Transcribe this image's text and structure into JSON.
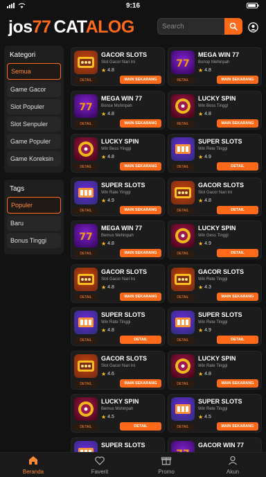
{
  "status": {
    "time": "9:16"
  },
  "header": {
    "logo_main": "jos",
    "logo_num": "77",
    "logo_cat": "CAT",
    "logo_alog": "ALOG",
    "search_placeholder": "Search"
  },
  "sidebar": {
    "categories_title": "Kategori",
    "categories": [
      {
        "label": "Semua",
        "active": true
      },
      {
        "label": "Game Gacor",
        "active": false
      },
      {
        "label": "Slot Populer",
        "active": false
      },
      {
        "label": "Slot Senpuler",
        "active": false
      },
      {
        "label": "Game Populer",
        "active": false
      },
      {
        "label": "Game Koreksin",
        "active": false
      }
    ],
    "tags_title": "Tags",
    "tags": [
      {
        "label": "Populer",
        "active": true
      },
      {
        "label": "Baru",
        "active": false
      },
      {
        "label": "Bonus Tinggi",
        "active": false
      }
    ]
  },
  "cards": [
    {
      "title": "GACOR SLOTS",
      "sub": "Slot Gacor Nari Ini",
      "rating": "4.8",
      "detail": "DETAIL",
      "action": "MAIN SEKARANG",
      "thumb": "gacor"
    },
    {
      "title": "MEGA WIN 77",
      "sub": "Bonop Mehinpah",
      "rating": "4.8",
      "detail": "RETAIL",
      "action": "MAIN SEKARANG",
      "thumb": "mega"
    },
    {
      "title": "MEGA WIN 77",
      "sub": "Bonce Mshinpah",
      "rating": "4.8",
      "detail": "DETAIL",
      "action": "MAIN SEKARANG",
      "thumb": "mega"
    },
    {
      "title": "LUCKY SPIN",
      "sub": "Win Boss Tinggl",
      "rating": "4.8",
      "detail": "RETAIL",
      "action": "MAIN SEKARANG",
      "thumb": "lucky"
    },
    {
      "title": "LUCKY SPIN",
      "sub": "Win Bess Yinggi",
      "rating": "4.8",
      "detail": "DETAIL",
      "action": "MAIN SEKARANG",
      "thumb": "lucky"
    },
    {
      "title": "SUPER SLOTS",
      "sub": "Win Rete Tinggi",
      "rating": "4.9",
      "detail": "DETAIL",
      "action": "DETAIL",
      "thumb": "super"
    },
    {
      "title": "SUPER SLOTS",
      "sub": "Win Rate Yinggi",
      "rating": "4.9",
      "detail": "DETAIL",
      "action": "MAIN SEKARANG",
      "thumb": "super"
    },
    {
      "title": "GACOR SLOTS",
      "sub": "Slot Gacor Nari Ini",
      "rating": "4.8",
      "detail": "DETAIL",
      "action": "DETAIL",
      "thumb": "gacor"
    },
    {
      "title": "MEGA WIN 77",
      "sub": "Bemus Mehinpah",
      "rating": "4.8",
      "detail": "DETAIL",
      "action": "MAIN SEKARANG",
      "thumb": "mega"
    },
    {
      "title": "LUCKY SPIN",
      "sub": "Win Gess Tinggl",
      "rating": "4.9",
      "detail": "DETAIL",
      "action": "DETAIL",
      "thumb": "lucky"
    },
    {
      "title": "GACOR SLOTS",
      "sub": "Slot Gacor Nari Ini",
      "rating": "4.8",
      "detail": "DETAIL",
      "action": "MAIN SEKARANG",
      "thumb": "gacor"
    },
    {
      "title": "GACOR SLOTS",
      "sub": "Win Rete Tinggi",
      "rating": "4.3",
      "detail": "DETAIL",
      "action": "MAIN SEKARANG",
      "thumb": "gacor"
    },
    {
      "title": "SUPER SLOTS",
      "sub": "Win Rate Tinggi",
      "rating": "4.8",
      "detail": "DETAIL",
      "action": "DETAIL",
      "thumb": "super"
    },
    {
      "title": "SUPER SLOTS",
      "sub": "Win Rete Tinggi",
      "rating": "4.9",
      "detail": "DETAIL",
      "action": "DETAIL",
      "thumb": "super"
    },
    {
      "title": "GACOR SLOTS",
      "sub": "Slot Gacor Nari Ini",
      "rating": "4.6",
      "detail": "DETAIL",
      "action": "MAIN SEKARANG",
      "thumb": "gacor"
    },
    {
      "title": "LUCKY SPIN",
      "sub": "Win Rate Tinggi",
      "rating": "4.8",
      "detail": "DETAIL",
      "action": "MAIN SEKARANG",
      "thumb": "lucky"
    },
    {
      "title": "LUCKY SPIN",
      "sub": "Bemus Mshinpah",
      "rating": "4.5",
      "detail": "DETAIL",
      "action": "DETAIL",
      "thumb": "lucky"
    },
    {
      "title": "SUPER SLOTS",
      "sub": "Win Rete Tinggi",
      "rating": "4.5",
      "detail": "DETAIL",
      "action": "MAIN SEKARANG",
      "thumb": "super"
    },
    {
      "title": "SUPER SLOTS",
      "sub": "",
      "rating": "",
      "detail": "",
      "action": "",
      "thumb": "super"
    },
    {
      "title": "GACOR WIN 77",
      "sub": "",
      "rating": "",
      "detail": "",
      "action": "",
      "thumb": "mega"
    }
  ],
  "nav": [
    {
      "label": "Beranda",
      "icon": "home-icon",
      "active": true
    },
    {
      "label": "Faverit",
      "icon": "heart-icon",
      "active": false
    },
    {
      "label": "Promo",
      "icon": "gift-icon",
      "active": false
    },
    {
      "label": "Akun",
      "icon": "user-icon",
      "active": false
    }
  ],
  "colors": {
    "accent": "#ff6a1a",
    "bg": "#121212",
    "card": "#1c1c1c"
  }
}
